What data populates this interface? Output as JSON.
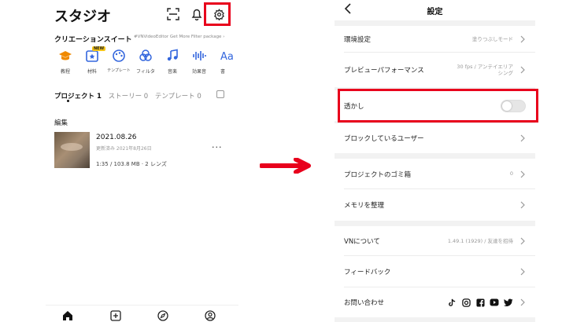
{
  "studio": {
    "title": "スタジオ",
    "creation_suite": {
      "title": "クリエーションスイート",
      "promo": "#VNVideoEditor Get More Filter package ›"
    },
    "tools": [
      {
        "label": "教程",
        "icon": "graduation-cap-icon"
      },
      {
        "label": "材料",
        "icon": "star-box-icon",
        "badge": "NEW"
      },
      {
        "label": "テンプレート",
        "icon": "palette-icon"
      },
      {
        "label": "フィルタ",
        "icon": "filter-circles-icon"
      },
      {
        "label": "音楽",
        "icon": "music-note-icon"
      },
      {
        "label": "効果音",
        "icon": "waveform-icon"
      },
      {
        "label": "書",
        "icon": "text-icon"
      }
    ],
    "tabs": [
      {
        "label": "プロジェクト 1",
        "active": true
      },
      {
        "label": "ストーリー 0",
        "active": false
      },
      {
        "label": "テンプレート 0",
        "active": false
      }
    ],
    "section_label": "編集",
    "project": {
      "date": "2021.08.26",
      "updated": "更新済み 2021年8月26日",
      "meta": "1:35  /  103.8 MB  ·  2 レンズ",
      "more": "···"
    }
  },
  "settings": {
    "title": "設定",
    "rows": [
      {
        "label": "環境設定",
        "value": "塗りつぶしモード"
      },
      {
        "label": "プレビューパフォーマンス",
        "value": "30 fps / アンテイエリア\nシング"
      },
      {
        "label": "透かし",
        "toggle": false
      },
      {
        "label": "ブロックしているユーザー",
        "value": ""
      },
      {
        "label": "プロジェクトのゴミ箱",
        "value": "0"
      },
      {
        "label": "メモリを整理",
        "value": ""
      },
      {
        "label": "VNについて",
        "value": "1.49.1 (1929) / 友達を招待"
      },
      {
        "label": "フィードバック",
        "value": ""
      },
      {
        "label": "お問い合わせ",
        "value": ""
      }
    ]
  },
  "colors": {
    "accent": "#f08a00",
    "tool_blue": "#3366dd",
    "highlight": "#e8001c"
  }
}
